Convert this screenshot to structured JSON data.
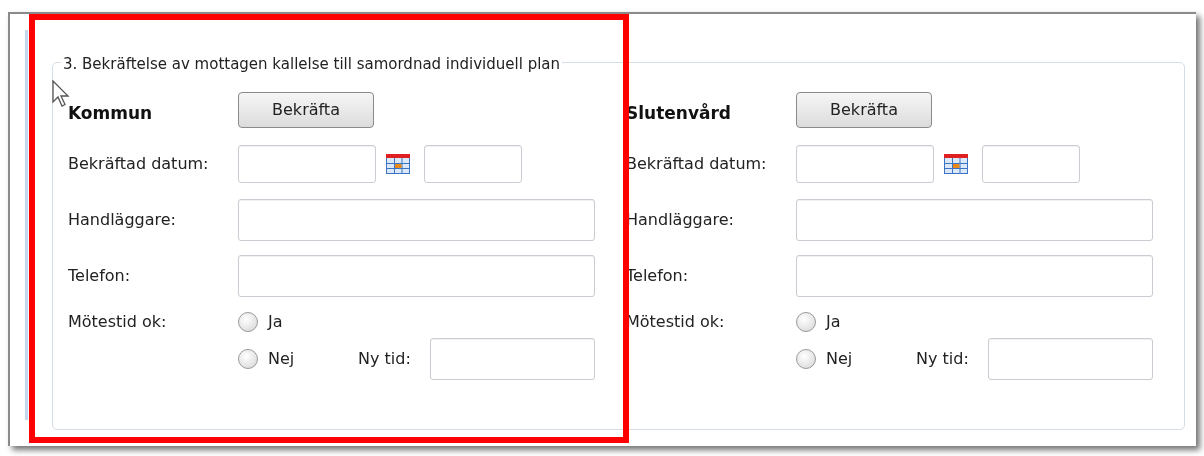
{
  "legend": "3. Bekräftelse av mottagen kallelse till samordnad individuell plan",
  "sections": [
    {
      "title": "Kommun",
      "confirm_button": "Bekräfta",
      "date_label": "Bekräftad datum:",
      "handler_label": "Handläggare:",
      "phone_label": "Telefon:",
      "meeting_label": "Mötestid ok:",
      "options": [
        {
          "label": "Ja",
          "selected": false
        },
        {
          "label": "Nej",
          "selected": false
        }
      ],
      "new_time_label": "Ny tid:"
    },
    {
      "title": "Slutenvård",
      "confirm_button": "Bekräfta",
      "date_label": "Bekräftad datum:",
      "handler_label": "Handläggare:",
      "phone_label": "Telefon:",
      "meeting_label": "Mötestid ok:",
      "options": [
        {
          "label": "Ja",
          "selected": false
        },
        {
          "label": "Nej",
          "selected": false
        }
      ],
      "new_time_label": "Ny tid:"
    }
  ]
}
